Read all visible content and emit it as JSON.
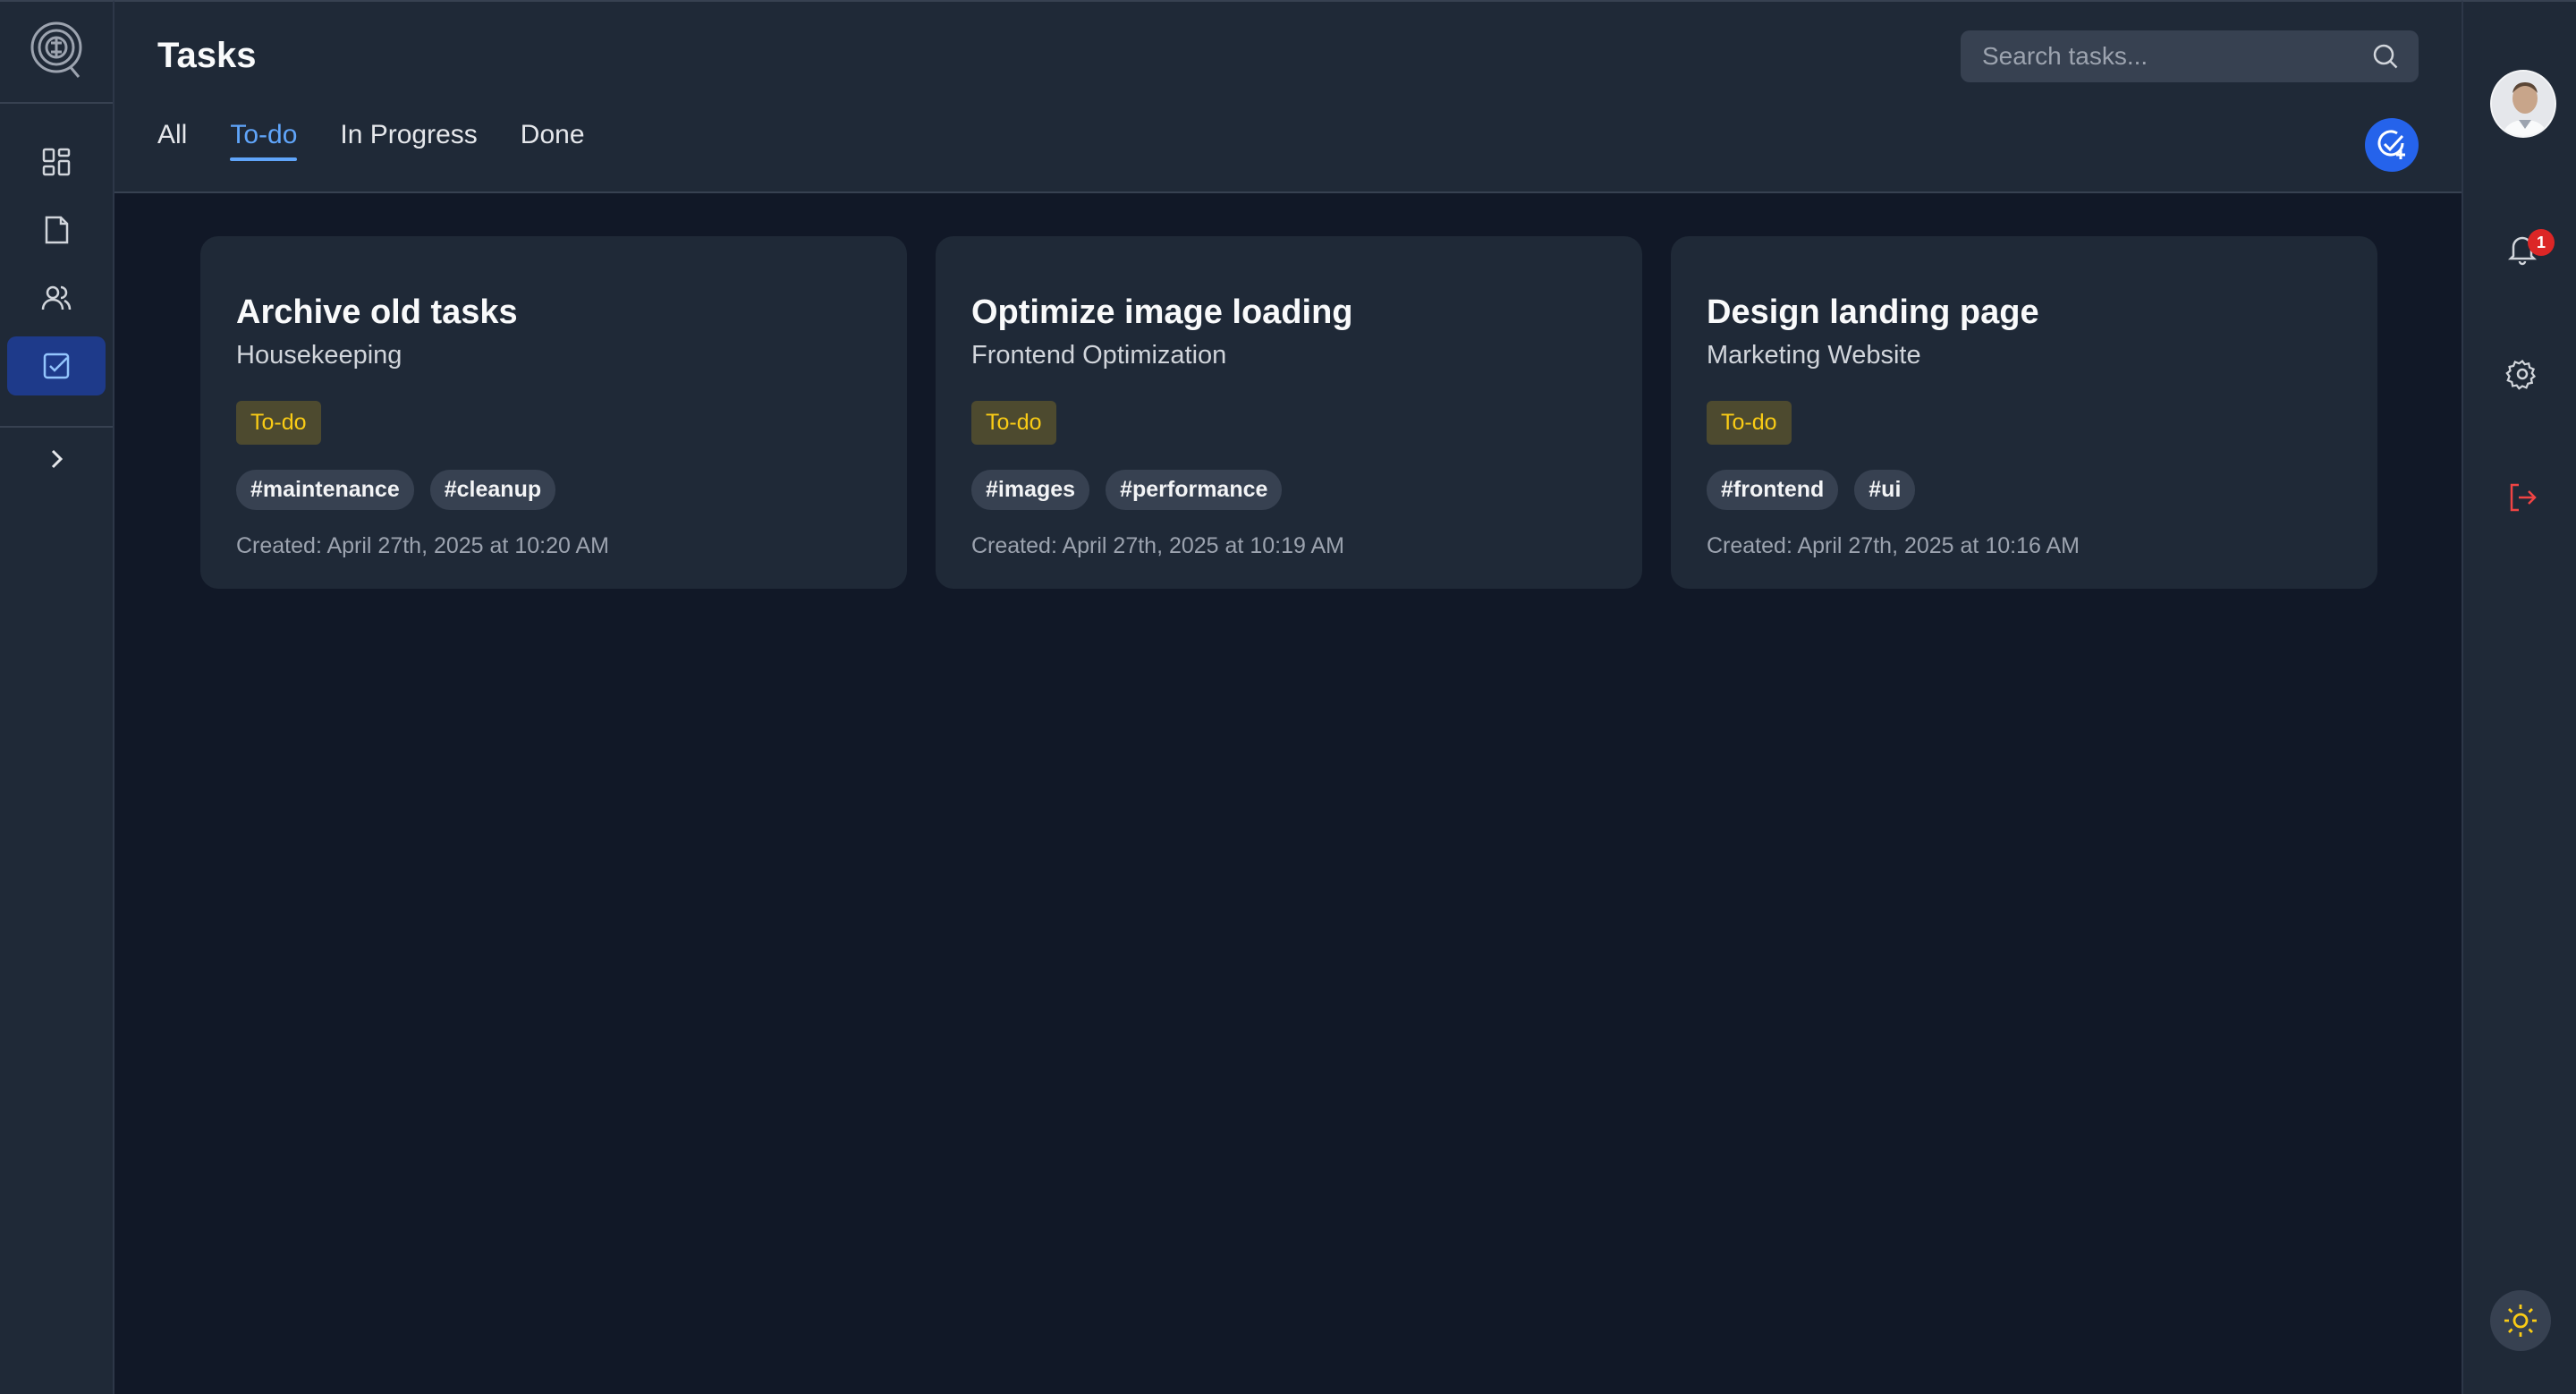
{
  "header": {
    "title": "Tasks",
    "search_placeholder": "Search tasks..."
  },
  "tabs": [
    {
      "label": "All",
      "active": false
    },
    {
      "label": "To-do",
      "active": true
    },
    {
      "label": "In Progress",
      "active": false
    },
    {
      "label": "Done",
      "active": false
    }
  ],
  "sidebar": {
    "items": [
      {
        "icon": "dashboard-icon"
      },
      {
        "icon": "document-icon"
      },
      {
        "icon": "users-icon"
      },
      {
        "icon": "tasks-checkbox-icon",
        "active": true
      }
    ],
    "expand_icon": "chevron-right-icon"
  },
  "right_sidebar": {
    "notification_count": "1",
    "icons": [
      "bell-icon",
      "gear-icon",
      "logout-icon",
      "sun-icon"
    ]
  },
  "cards": [
    {
      "title": "Archive old tasks",
      "project": "Housekeeping",
      "status": "To-do",
      "tags": [
        "#maintenance",
        "#cleanup"
      ],
      "created": "Created: April 27th, 2025 at 10:20 AM"
    },
    {
      "title": "Optimize image loading",
      "project": "Frontend Optimization",
      "status": "To-do",
      "tags": [
        "#images",
        "#performance"
      ],
      "created": "Created: April 27th, 2025 at 10:19 AM"
    },
    {
      "title": "Design landing page",
      "project": "Marketing Website",
      "status": "To-do",
      "tags": [
        "#frontend",
        "#ui"
      ],
      "created": "Created: April 27th, 2025 at 10:16 AM"
    }
  ],
  "colors": {
    "background": "#111827",
    "panel": "#1f2937",
    "accent": "#60a5fa",
    "status_todo": "#facc15",
    "logout": "#ef4444"
  }
}
